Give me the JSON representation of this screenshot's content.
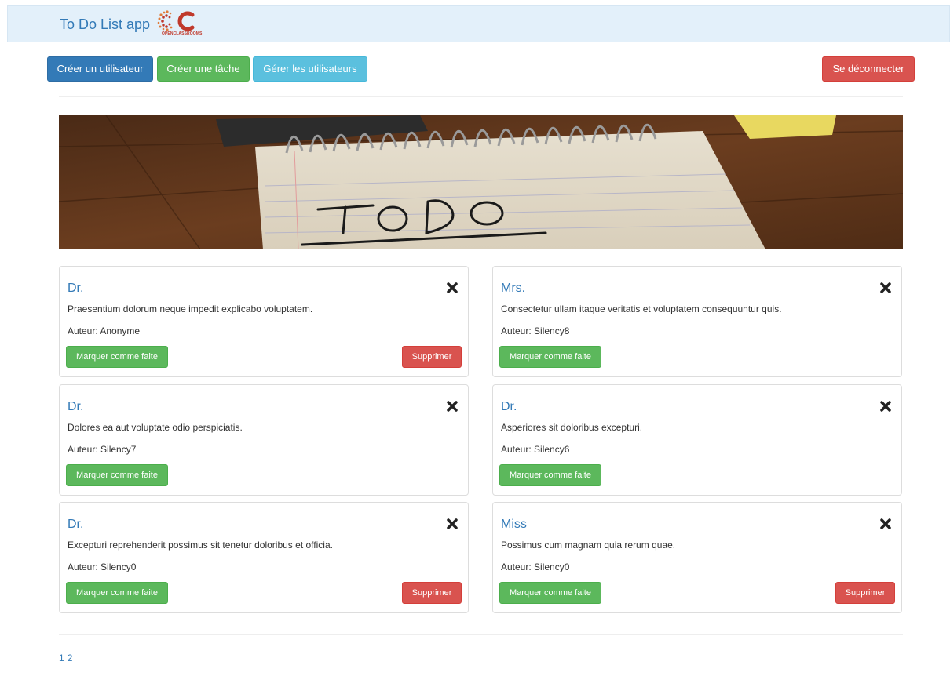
{
  "navbar": {
    "brand": "To Do List app",
    "logo_text": "OPENCLASSROOMS",
    "logo_color": "#c0392b"
  },
  "toolbar": {
    "create_user": "Créer un utilisateur",
    "create_task": "Créer une tâche",
    "manage_users": "Gérer les utilisateurs",
    "logout": "Se déconnecter"
  },
  "banner": {
    "handwriting": "TO DO"
  },
  "tasks": [
    {
      "title": "Dr.",
      "description": "Praesentium dolorum neque impedit explicabo voluptatem.",
      "author": "Auteur: Anonyme",
      "done_label": "Marquer comme faite",
      "delete_label": "Supprimer"
    },
    {
      "title": "Mrs.",
      "description": "Consectetur ullam itaque veritatis et voluptatem consequuntur quis.",
      "author": "Auteur: Silency8",
      "done_label": "Marquer comme faite"
    },
    {
      "title": "Dr.",
      "description": "Dolores ea aut voluptate odio perspiciatis.",
      "author": "Auteur: Silency7",
      "done_label": "Marquer comme faite"
    },
    {
      "title": "Dr.",
      "description": "Asperiores sit doloribus excepturi.",
      "author": "Auteur: Silency6",
      "done_label": "Marquer comme faite"
    },
    {
      "title": "Dr.",
      "description": "Excepturi reprehenderit possimus sit tenetur doloribus et officia.",
      "author": "Auteur: Silency0",
      "done_label": "Marquer comme faite",
      "delete_label": "Supprimer"
    },
    {
      "title": "Miss",
      "description": "Possimus cum magnam quia rerum quae.",
      "author": "Auteur: Silency0",
      "done_label": "Marquer comme faite",
      "delete_label": "Supprimer"
    }
  ],
  "pagination": {
    "pages": [
      "1",
      "2"
    ]
  },
  "colors": {
    "navbar_bg": "#e3f0fa",
    "primary": "#337ab7",
    "success": "#5cb85c",
    "info": "#5bc0de",
    "danger": "#d9534f"
  }
}
